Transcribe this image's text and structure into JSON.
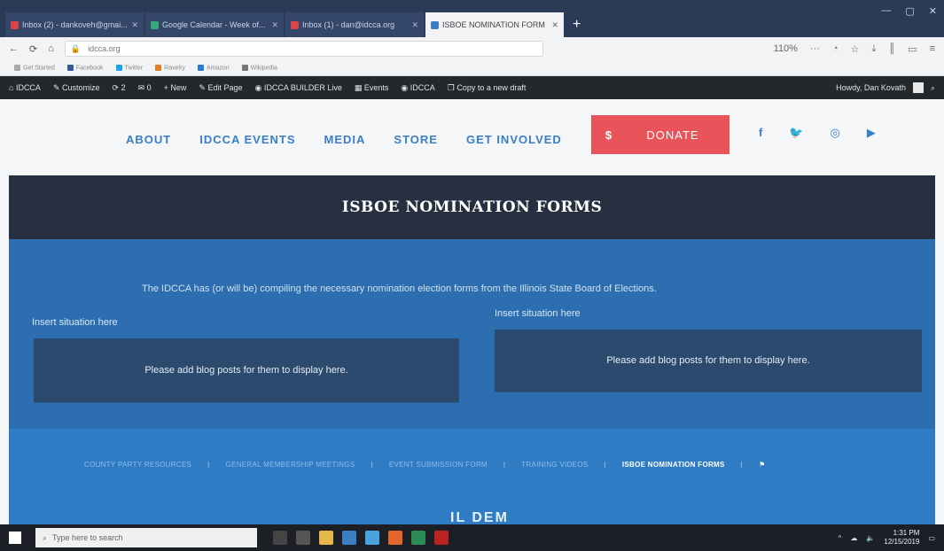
{
  "browser": {
    "tabs": [
      {
        "label": "Inbox (2) - dankoveh@gmai...",
        "color": "#d44"
      },
      {
        "label": "Google Calendar - Week of...",
        "color": "#3a7"
      },
      {
        "label": "Inbox (1) - dan@idcca.org",
        "color": "#d44"
      },
      {
        "label": "ISBOE NOMINATION FORM",
        "color": "#3a7fc4",
        "active": true
      }
    ],
    "url": "idcca.org",
    "zoom": "110%"
  },
  "bookmarks": [
    "Get Started",
    "Facebook",
    "Twitter",
    "Ravelry",
    "Amazon",
    "Wikipedia"
  ],
  "wpbar": {
    "items": [
      "IDCCA",
      "Customize",
      "2",
      "0",
      "+ New",
      "Edit Page",
      "IDCCA BUILDER Live",
      "Events",
      "IDCCA",
      "Copy to a new draft"
    ],
    "howdy": "Howdy, Dan Kovath"
  },
  "site": {
    "menu": [
      "ABOUT",
      "IDCCA EVENTS",
      "MEDIA",
      "STORE",
      "GET INVOLVED"
    ],
    "donate_symbol": "$",
    "donate_label": "DONATE",
    "social": [
      "f",
      "t",
      "ig",
      "yt"
    ]
  },
  "page": {
    "title": "ISBOE NOMINATION FORMS",
    "intro": "The IDCCA has (or will be) compiling the necessary nomination election forms from the Illinois State Board of Elections.",
    "left_situation": "Insert situation here",
    "right_situation": "Insert situation here",
    "left_card": "Please add blog posts for them to display here.",
    "right_card": "Please add blog posts for them to display here."
  },
  "footer": {
    "links": [
      "COUNTY PARTY RESOURCES",
      "GENERAL MEMBERSHIP MEETINGS",
      "EVENT SUBMISSION FORM",
      "TRAINING VIDEOS",
      "ISBOE NOMINATION FORMS"
    ],
    "active_index": 4,
    "brand": "IL DEM"
  },
  "taskbar": {
    "search_placeholder": "Type here to search",
    "time": "1:31 PM",
    "date": "12/15/2019"
  }
}
